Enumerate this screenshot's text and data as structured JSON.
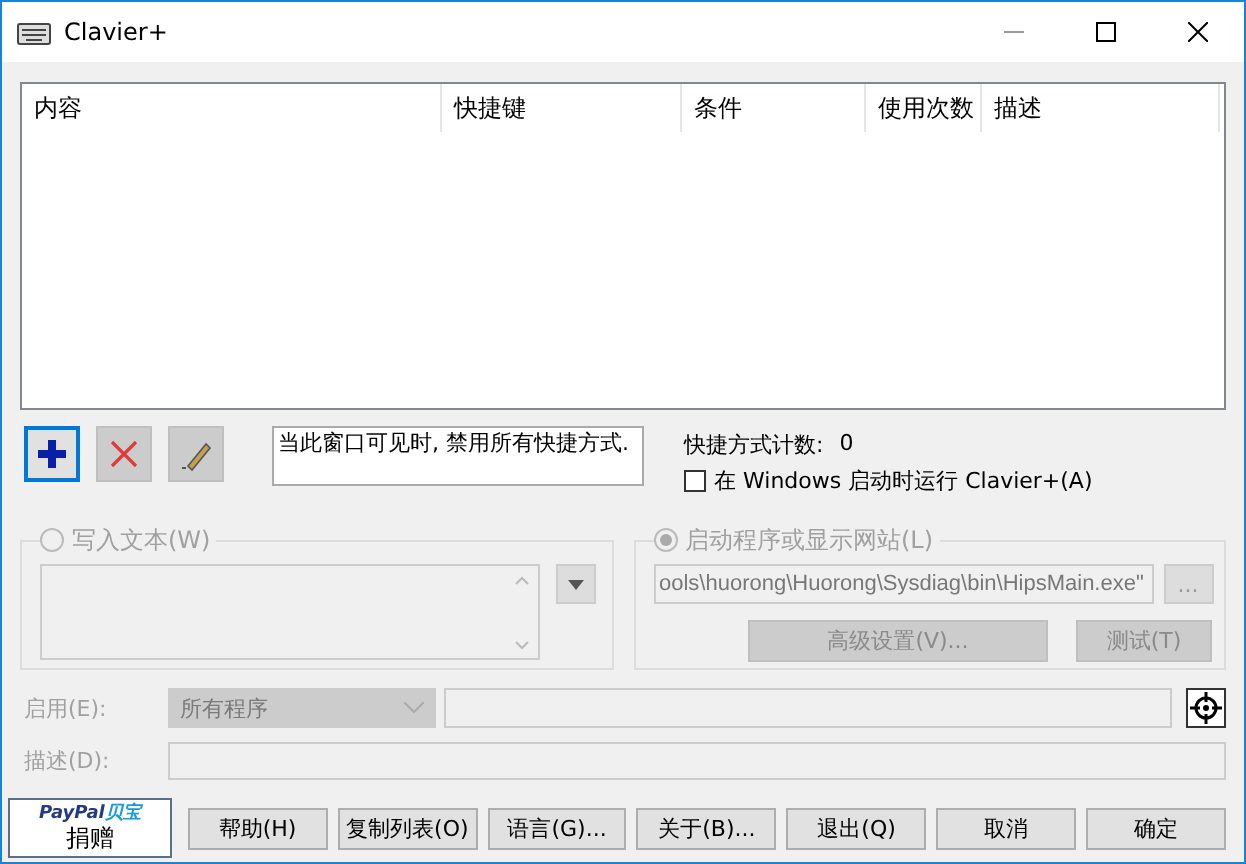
{
  "window": {
    "title": "Clavier+"
  },
  "table": {
    "columns": [
      "内容",
      "快捷键",
      "条件",
      "使用次数",
      "描述"
    ]
  },
  "toolbar": [
    {
      "kind": "add",
      "disabled": false
    },
    {
      "kind": "delete",
      "disabled": true
    },
    {
      "kind": "edit",
      "disabled": true
    }
  ],
  "notice": "当此窗口可见时, 禁用所有快捷方式.",
  "shortcut_count": {
    "label": "快捷方式计数:",
    "value": "0"
  },
  "startup_checkbox": {
    "label": "在 Windows 启动时运行 Clavier+(A)",
    "checked": false
  },
  "write_text": {
    "label": "写入文本(W)",
    "selected": false,
    "disabled": true
  },
  "launch": {
    "label": "启动程序或显示网站(L)",
    "selected": true,
    "disabled": true,
    "value": "ools\\huorong\\Huorong\\Sysdiag\\bin\\HipsMain.exe\"",
    "browse": "...",
    "buttons": [
      "高级设置(V)...",
      "测试(T)"
    ]
  },
  "enable": {
    "label": "启用(E):",
    "value": "所有程序",
    "disabled": true
  },
  "description": {
    "label": "描述(D):",
    "disabled": true
  },
  "donate": {
    "brand": "PayPal",
    "brand_cn": "贝宝",
    "label": "捐赠"
  },
  "buttons": [
    "帮助(H)",
    "复制列表(O)",
    "语言(G)...",
    "关于(B)...",
    "退出(Q)",
    "取消",
    "确定"
  ]
}
